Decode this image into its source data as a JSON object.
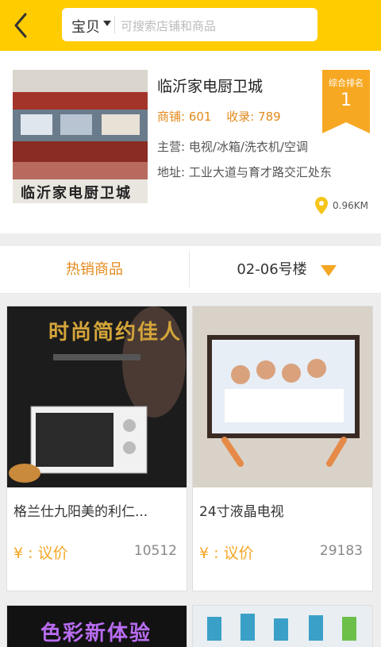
{
  "header": {
    "search_category": "宝贝",
    "search_placeholder": "可搜索店铺和商品",
    "colors": {
      "brand": "#ffcc00"
    }
  },
  "store": {
    "name": "临沂家电厨卫城",
    "image_text": "临沂家电厨卫城",
    "stats": {
      "shops": "商铺: 601",
      "records": "收录: 789"
    },
    "main": "主营: 电视/冰箱/洗衣机/空调",
    "address": "地址: 工业大道与育才路交汇处东",
    "rank": {
      "label": "综合排名",
      "value": "1"
    },
    "distance": "0.96KM"
  },
  "tabs": {
    "hot": "热销商品",
    "floor": "02-06号楼"
  },
  "products": [
    {
      "title": "格兰仕九阳美的利仁...",
      "price": "¥ : 议价",
      "sales": "10512",
      "image_text": "时尚简约佳人"
    },
    {
      "title": "24寸液晶电视",
      "price": "¥ : 议价",
      "sales": "29183"
    },
    {
      "title": "",
      "price": "",
      "sales": "",
      "image_text": "色彩新体验"
    },
    {
      "title": "",
      "price": "",
      "sales": ""
    }
  ]
}
